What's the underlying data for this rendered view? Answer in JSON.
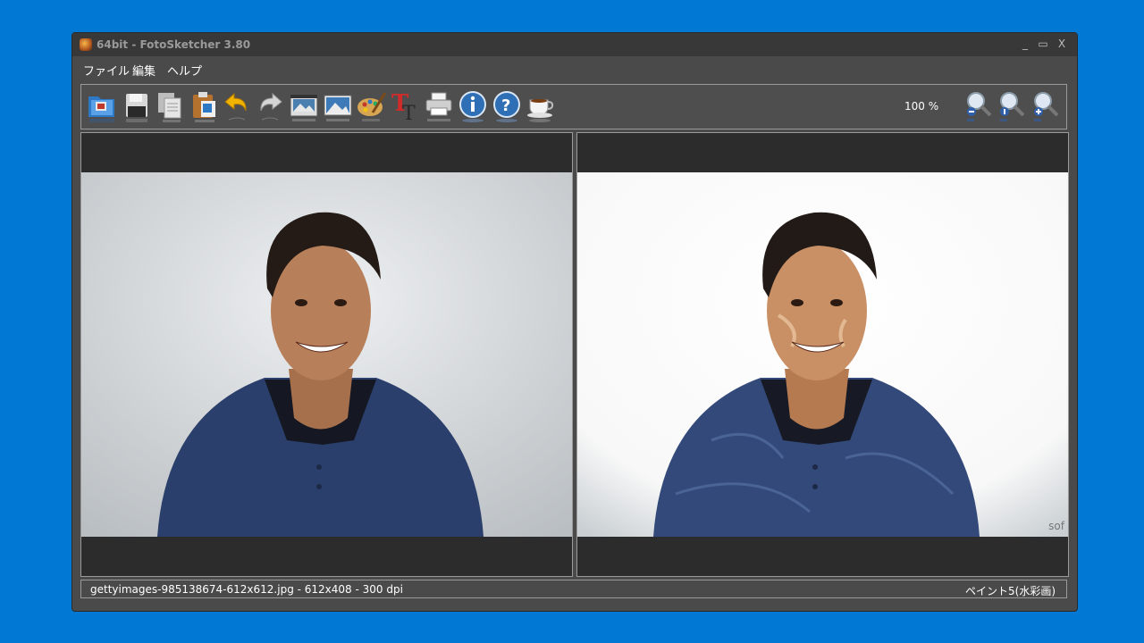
{
  "window": {
    "title": "64bit - FotoSketcher 3.80",
    "controls": {
      "minimize": "_",
      "maximize": "▭",
      "close": "X"
    }
  },
  "menu": {
    "items": [
      {
        "label": "ファイル"
      },
      {
        "label": "編集"
      },
      {
        "label": "ヘルプ"
      }
    ]
  },
  "toolbar": {
    "icons": [
      "open-folder-icon",
      "save-icon",
      "copy-icon",
      "paste-icon",
      "undo-icon",
      "redo-icon",
      "film-icon",
      "landscape-icon",
      "palette-icon",
      "text-icon",
      "print-icon",
      "info-icon",
      "help-icon",
      "coffee-icon"
    ],
    "zoom_text": "100 %",
    "zoom_icons": [
      "zoom-out-icon",
      "zoom-reset-icon",
      "zoom-in-icon"
    ]
  },
  "panels": {
    "watermark": "sof"
  },
  "status": {
    "file_info": "gettyimages-985138674-612x612.jpg - 612x408 - 300 dpi",
    "effect": "ペイント5(水彩画)"
  },
  "colors": {
    "desktop": "#0078d4",
    "window_bg": "#4a4a4a",
    "titlebar": "#383838",
    "panel_bg": "#2c2c2c",
    "shirt": "#2a3f6b",
    "skin": "#b8805a",
    "hair": "#241b17"
  }
}
